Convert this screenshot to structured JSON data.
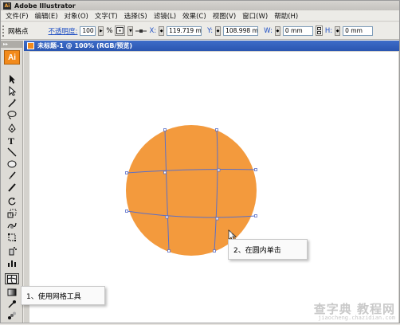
{
  "window": {
    "title": "Adobe Illustrator",
    "icon_label": "Ai"
  },
  "menubar": {
    "items": [
      "文件(F)",
      "编辑(E)",
      "对象(O)",
      "文字(T)",
      "选择(S)",
      "滤镜(L)",
      "效果(C)",
      "视图(V)",
      "窗口(W)",
      "帮助(H)"
    ]
  },
  "controlbar": {
    "selection_label": "网格点",
    "opacity_label": "不透明度:",
    "opacity_value": "100",
    "opacity_unit": "%",
    "x_label": "X:",
    "x_value": "119.719 mm",
    "y_label": "Y:",
    "y_value": "108.998 mm",
    "w_label": "W:",
    "w_value": "0 mm",
    "h_label": "H:",
    "h_value": "0 mm"
  },
  "toolbox": {
    "logo": "Ai",
    "tools": [
      "selection-tool",
      "direct-selection-tool",
      "magic-wand-tool",
      "lasso-tool",
      "pen-tool",
      "type-tool",
      "line-segment-tool",
      "ellipse-tool",
      "paintbrush-tool",
      "pencil-tool",
      "rotate-tool",
      "scale-tool",
      "warp-tool",
      "free-transform-tool",
      "symbol-sprayer-tool",
      "column-graph-tool",
      "mesh-tool",
      "gradient-tool",
      "eyedropper-tool",
      "blend-tool"
    ],
    "active_tool": "mesh-tool"
  },
  "document": {
    "tab_title": "未标题-1 @ 100% (RGB/预览)"
  },
  "canvas": {
    "object": "mesh-circle",
    "fill_color": "#f39a3d",
    "mesh_line_color": "#5a6fc8"
  },
  "callouts": {
    "step1": "1、使用网格工具",
    "step2": "2、在圆内单击"
  },
  "watermark": {
    "main": "查字典 教程网",
    "sub": "jiaocheng.chazidian.com"
  }
}
